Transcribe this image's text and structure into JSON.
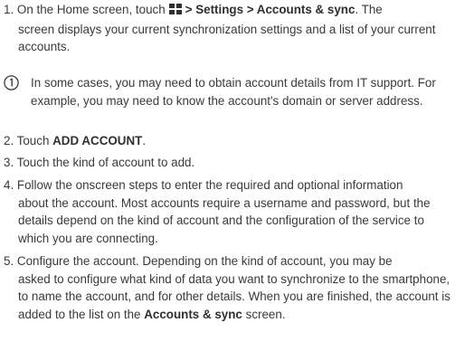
{
  "steps": [
    {
      "num": "1.",
      "pre": "On the Home screen, touch",
      "bold": "> Settings > Accounts & sync",
      "post": ". The",
      "cont": "screen displays your current synchronization settings and a list of your current accounts.",
      "icon": "apps-grid-icon"
    },
    {
      "num": "2.",
      "pre": "Touch",
      "bold": "ADD ACCOUNT",
      "post": "."
    },
    {
      "num": "3.",
      "text": "Touch the kind of account to add."
    },
    {
      "num": "4.",
      "first": "Follow the onscreen steps to enter the required and optional information",
      "cont": "about the account. Most accounts require a username and password, but the details depend on the kind of account and the configuration of the service to which you are connecting."
    },
    {
      "num": "5.",
      "first": "Configure the account. Depending on the kind of account, you may be",
      "cont_pre": "asked to configure what kind of data you want to synchronize to the smartphone, to name the account, and for other details. When you are finished, the account is added to the list on the",
      "cont_bold": "Accounts & sync",
      "cont_post": "screen."
    }
  ],
  "note": {
    "icon": "info-note-icon",
    "text": "In some cases, you may need to obtain account details from IT support. For example, you may need to know the account's domain or server address."
  }
}
